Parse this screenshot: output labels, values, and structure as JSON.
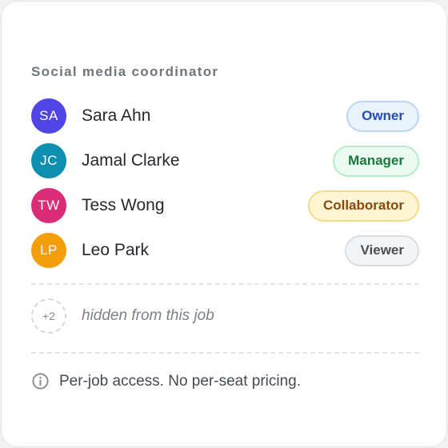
{
  "section": {
    "title": "Social media coordinator"
  },
  "members": [
    {
      "initials": "SA",
      "name": "Sara Ahn",
      "role": "Owner",
      "avatar_color": "#4f46e5",
      "badge_bg": "#eaf2fe",
      "badge_border": "#bcd4f8",
      "badge_text": "#1f4fb6"
    },
    {
      "initials": "JC",
      "name": "Jamal Clarke",
      "role": "Manager",
      "avatar_color": "#0e8fb0",
      "badge_bg": "#ecfbf1",
      "badge_border": "#b4ecc8",
      "badge_text": "#18783c"
    },
    {
      "initials": "TW",
      "name": "Tess Wong",
      "role": "Collaborator",
      "avatar_color": "#d92d78",
      "badge_bg": "#fdf5d3",
      "badge_border": "#f3dc86",
      "badge_text": "#8a4a0c"
    },
    {
      "initials": "LP",
      "name": "Leo Park",
      "role": "Viewer",
      "avatar_color": "#f59e0b",
      "badge_bg": "#f3f4f6",
      "badge_border": "#dcdde1",
      "badge_text": "#4a4e55"
    }
  ],
  "hidden": {
    "count_label": "+2",
    "label": "hidden from this job"
  },
  "footer": {
    "icon": "info-icon",
    "note": "Per-job access. No per-seat pricing."
  }
}
